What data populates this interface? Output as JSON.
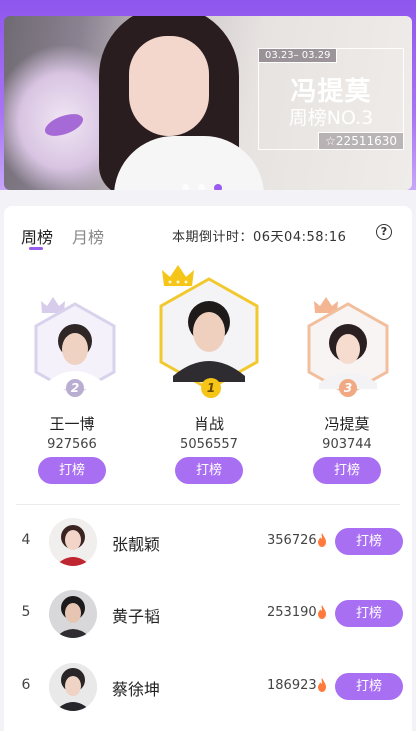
{
  "banner": {
    "date_range": "03.23– 03.29",
    "star_name": "冯提莫",
    "rank_text": "周榜NO.3",
    "score": "22511630",
    "score_icon": "star-icon",
    "dots": 3,
    "active_dot": 2
  },
  "tabs": [
    {
      "label": "周榜",
      "active": true
    },
    {
      "label": "月榜",
      "active": false
    }
  ],
  "countdown": "本期倒计时：06天04:58:16",
  "help_icon": "question-icon",
  "top3": [
    {
      "rank": "2",
      "name": "王一博",
      "score": "927566",
      "button": "打榜",
      "crown_color": "#d7ccec",
      "frame_color": "#d9d2ec",
      "badge_color": "#b9aed2"
    },
    {
      "rank": "1",
      "name": "肖战",
      "score": "5056557",
      "button": "打榜",
      "crown_color": "#f5c518",
      "frame_color": "#f1c92e",
      "badge_color": "#f5c518"
    },
    {
      "rank": "3",
      "name": "冯提莫",
      "score": "903744",
      "button": "打榜",
      "crown_color": "#f4b592",
      "frame_color": "#f2bf9d",
      "badge_color": "#f0a982"
    }
  ],
  "list": [
    {
      "rank": "4",
      "name": "张靓颖",
      "score": "356726",
      "button": "打榜"
    },
    {
      "rank": "5",
      "name": "黄子韬",
      "score": "253190",
      "button": "打榜"
    },
    {
      "rank": "6",
      "name": "蔡徐坤",
      "score": "186923",
      "button": "打榜"
    }
  ],
  "colors": {
    "accent": "#9a5cf0",
    "button": "#a86ff3",
    "fire": "#ff7a3c"
  }
}
